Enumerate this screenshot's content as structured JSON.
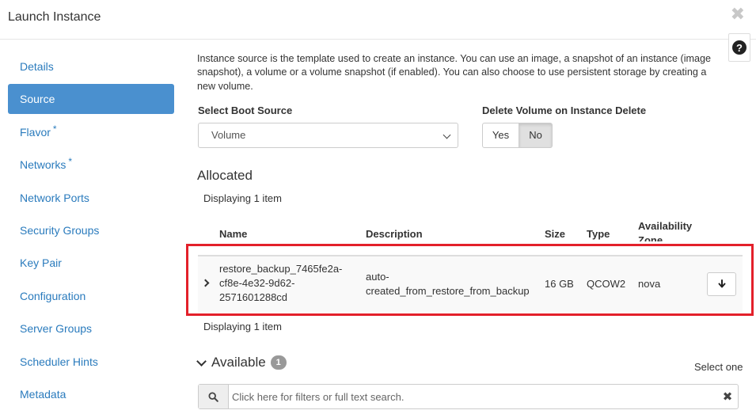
{
  "modal": {
    "title": "Launch Instance",
    "close_symbol": "✖",
    "help_symbol": "?"
  },
  "sidebar": {
    "items": [
      {
        "label": "Details",
        "required": false
      },
      {
        "label": "Source",
        "required": false,
        "active": true
      },
      {
        "label": "Flavor",
        "required": true
      },
      {
        "label": "Networks",
        "required": true
      },
      {
        "label": "Network Ports",
        "required": false
      },
      {
        "label": "Security Groups",
        "required": false
      },
      {
        "label": "Key Pair",
        "required": false
      },
      {
        "label": "Configuration",
        "required": false
      },
      {
        "label": "Server Groups",
        "required": false
      },
      {
        "label": "Scheduler Hints",
        "required": false
      },
      {
        "label": "Metadata",
        "required": false
      }
    ],
    "required_marker": "*"
  },
  "source": {
    "intro_lines": [
      "Instance source is the template used to create an instance. You can use an image, a snapshot of an instance (image",
      "snapshot), a volume or a volume snapshot (if enabled). You can also choose to use persistent storage by creating a",
      "new volume."
    ],
    "boot_source_label": "Select Boot Source",
    "boot_source_value": "Volume",
    "delete_volume_label": "Delete Volume on Instance Delete",
    "delete_yes": "Yes",
    "delete_no": "No"
  },
  "allocated": {
    "title": "Allocated",
    "displaying_top": "Displaying 1 item",
    "displaying_bottom": "Displaying 1 item",
    "columns": {
      "name": "Name",
      "description": "Description",
      "size": "Size",
      "type": "Type",
      "zone_line1": "Availability",
      "zone_line2": "Zone"
    },
    "row": {
      "name_lines": [
        "restore_backup_7465fe2a-",
        "cf8e-4e32-9d62-",
        "2571601288cd"
      ],
      "description_lines": [
        "auto-",
        "created_from_restore_from_backup"
      ],
      "size": "16 GB",
      "type": "QCOW2",
      "zone": "nova"
    }
  },
  "available": {
    "title": "Available",
    "count": "1",
    "select_hint": "Select one",
    "search_placeholder": "Click here for filters or full text search."
  },
  "colors": {
    "accent": "#4a90cf",
    "link": "#2a7bbd",
    "highlight": "#e3202a"
  },
  "icons": [
    "close-icon",
    "help-icon",
    "chevron-down-icon",
    "chevron-right-icon",
    "arrow-down-icon",
    "search-icon",
    "clear-icon"
  ]
}
